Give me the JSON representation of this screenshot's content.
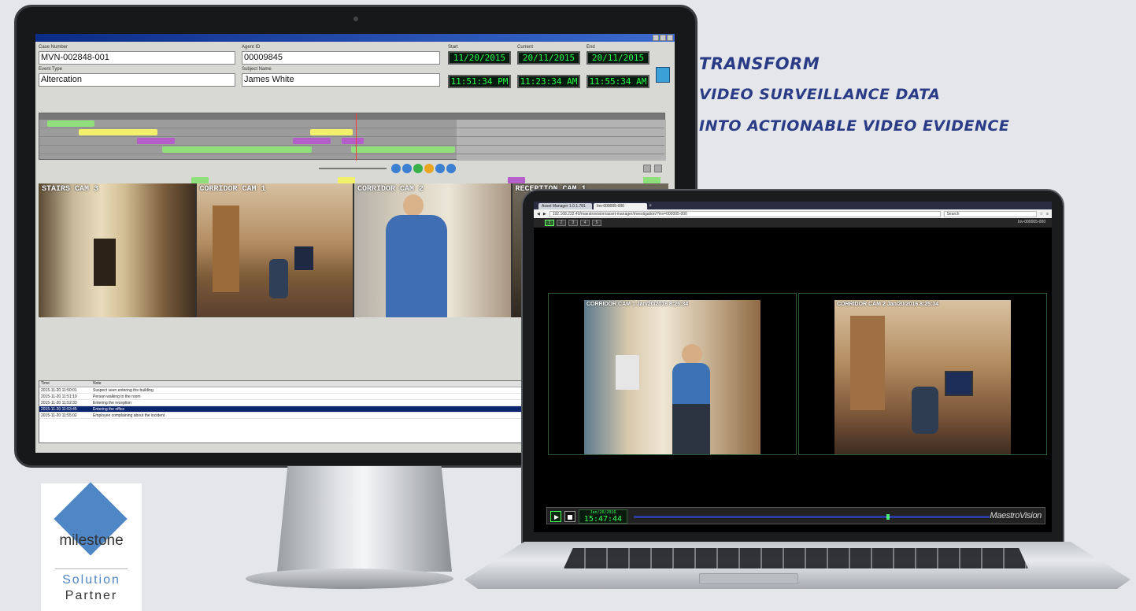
{
  "tagline": {
    "line1": "Transform",
    "line2": "video surveillance data",
    "line3": "into actionable video evidence"
  },
  "desktop_app": {
    "fields": {
      "case_number_label": "Case Number",
      "case_number": "MVN-002848-001",
      "agent_label": "Agent ID",
      "agent_id": "00009845",
      "event_type_label": "Event Type",
      "event_type": "Altercation",
      "subject_label": "Subject Name",
      "subject_name": "James White"
    },
    "clocks": {
      "start_label": "Start",
      "start_date": "11/20/2015",
      "start_time": "11:51:34 PM",
      "current_label": "Current",
      "current_date": "20/11/2015",
      "current_time": "11:23:34 AM",
      "end_label": "End",
      "end_date": "20/11/2015",
      "end_time": "11:55:34 AM"
    },
    "cameras": [
      {
        "label": "STAIRS CAM 3"
      },
      {
        "label": "CORRIDOR CAM 1"
      },
      {
        "label": "CORRIDOR CAM 2"
      },
      {
        "label": "RECEPTION CAM 1"
      }
    ],
    "log": {
      "columns": [
        "Time",
        "Note"
      ],
      "rows": [
        {
          "time": "2015-11-20 11:50:01",
          "note": "Suspect seen entering the building"
        },
        {
          "time": "2015-11-20 11:51:10",
          "note": "Person walking to the room"
        },
        {
          "time": "2015-11-20 11:52:33",
          "note": "Entering the reception"
        },
        {
          "time": "2015-11-20 11:53:45",
          "note": "Entering the office"
        },
        {
          "time": "2015-11-20 11:55:02",
          "note": "Employee complaining about the incident"
        }
      ]
    }
  },
  "laptop_app": {
    "tabs": [
      "Asset Manager 1.0.1.781",
      "Inv-000005-000"
    ],
    "url": "192.168.222.40/maestrovision/asset-manager/investigation/?inv=000005-000",
    "search_placeholder": "Search",
    "investigation_id": "Inv-000005-000",
    "layout_buttons": [
      "1",
      "2",
      "3",
      "4",
      "5"
    ],
    "cameras": [
      {
        "label": "CORRIDOR CAM 1  Jan/20/2016 8:25:34"
      },
      {
        "label": "CORRIDOR CAM 2  Jan/20/2016 8:25:34"
      }
    ],
    "player": {
      "date": "Jan/20/2016",
      "time": "15:47:44",
      "brand": "MaestroVision",
      "progress": 0.71
    }
  },
  "badge": {
    "brand": "milestone",
    "line1": "Solution",
    "line2": "Partner"
  },
  "colors": {
    "tagline": "#2b3c86",
    "lcd_green": "#26ff4a",
    "milestone_blue": "#4f86c6",
    "player_track": "#2e3b9e"
  }
}
